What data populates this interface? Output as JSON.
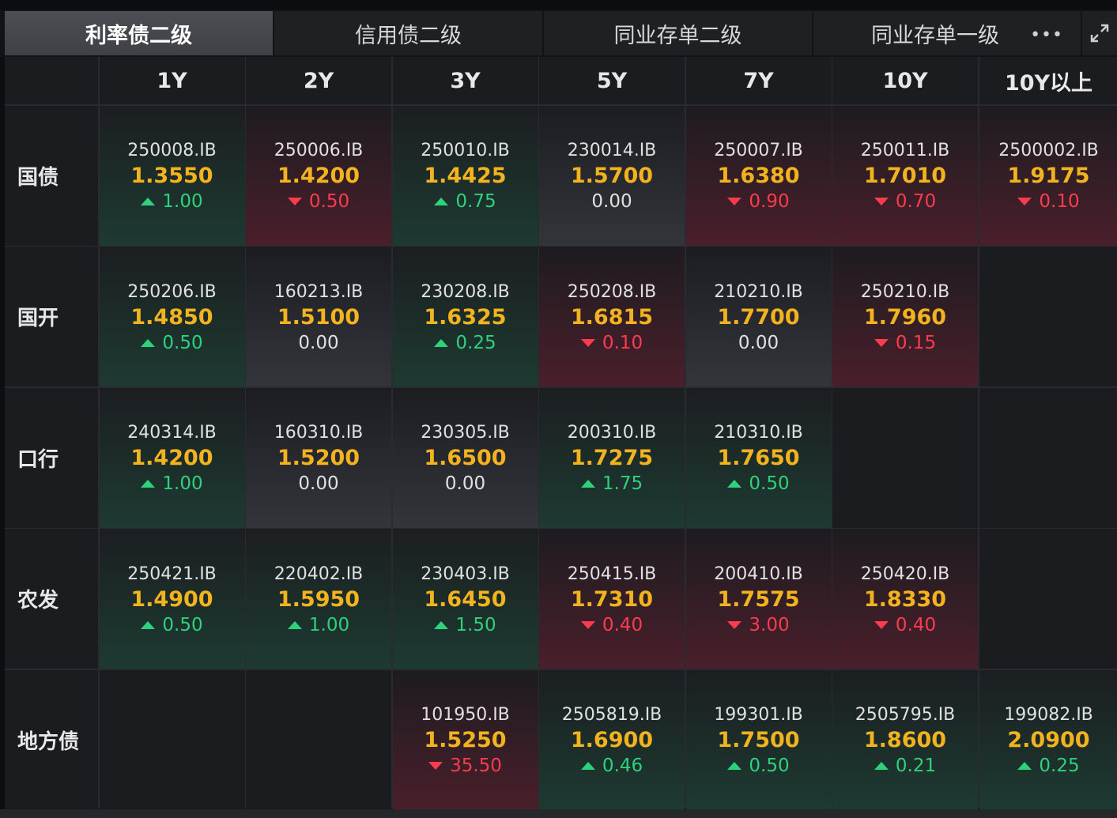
{
  "tabs": [
    {
      "label": "利率债二级",
      "active": true
    },
    {
      "label": "信用债二级",
      "active": false
    },
    {
      "label": "同业存单二级",
      "active": false
    },
    {
      "label": "同业存单一级",
      "active": false
    }
  ],
  "icons": {
    "more": "more-horizontal-icon",
    "expand": "expand-icon"
  },
  "colors": {
    "rate": "#f2b31f",
    "up": "#2ed17c",
    "down": "#ff3b4e"
  },
  "columns": [
    "1Y",
    "2Y",
    "3Y",
    "5Y",
    "7Y",
    "10Y",
    "10Y以上"
  ],
  "rows": [
    {
      "name": "国债",
      "cells": [
        {
          "code": "250008.IB",
          "rate": "1.3550",
          "change": "1.00",
          "dir": "up"
        },
        {
          "code": "250006.IB",
          "rate": "1.4200",
          "change": "0.50",
          "dir": "down"
        },
        {
          "code": "250010.IB",
          "rate": "1.4425",
          "change": "0.75",
          "dir": "up"
        },
        {
          "code": "230014.IB",
          "rate": "1.5700",
          "change": "0.00",
          "dir": "flat"
        },
        {
          "code": "250007.IB",
          "rate": "1.6380",
          "change": "0.90",
          "dir": "down"
        },
        {
          "code": "250011.IB",
          "rate": "1.7010",
          "change": "0.70",
          "dir": "down"
        },
        {
          "code": "2500002.IB",
          "rate": "1.9175",
          "change": "0.10",
          "dir": "down"
        }
      ]
    },
    {
      "name": "国开",
      "cells": [
        {
          "code": "250206.IB",
          "rate": "1.4850",
          "change": "0.50",
          "dir": "up"
        },
        {
          "code": "160213.IB",
          "rate": "1.5100",
          "change": "0.00",
          "dir": "flat"
        },
        {
          "code": "230208.IB",
          "rate": "1.6325",
          "change": "0.25",
          "dir": "up"
        },
        {
          "code": "250208.IB",
          "rate": "1.6815",
          "change": "0.10",
          "dir": "down"
        },
        {
          "code": "210210.IB",
          "rate": "1.7700",
          "change": "0.00",
          "dir": "flat"
        },
        {
          "code": "250210.IB",
          "rate": "1.7960",
          "change": "0.15",
          "dir": "down"
        },
        null
      ]
    },
    {
      "name": "口行",
      "cells": [
        {
          "code": "240314.IB",
          "rate": "1.4200",
          "change": "1.00",
          "dir": "up"
        },
        {
          "code": "160310.IB",
          "rate": "1.5200",
          "change": "0.00",
          "dir": "flat"
        },
        {
          "code": "230305.IB",
          "rate": "1.6500",
          "change": "0.00",
          "dir": "flat"
        },
        {
          "code": "200310.IB",
          "rate": "1.7275",
          "change": "1.75",
          "dir": "up"
        },
        {
          "code": "210310.IB",
          "rate": "1.7650",
          "change": "0.50",
          "dir": "up"
        },
        null,
        null
      ]
    },
    {
      "name": "农发",
      "cells": [
        {
          "code": "250421.IB",
          "rate": "1.4900",
          "change": "0.50",
          "dir": "up"
        },
        {
          "code": "220402.IB",
          "rate": "1.5950",
          "change": "1.00",
          "dir": "up"
        },
        {
          "code": "230403.IB",
          "rate": "1.6450",
          "change": "1.50",
          "dir": "up"
        },
        {
          "code": "250415.IB",
          "rate": "1.7310",
          "change": "0.40",
          "dir": "down"
        },
        {
          "code": "200410.IB",
          "rate": "1.7575",
          "change": "3.00",
          "dir": "down"
        },
        {
          "code": "250420.IB",
          "rate": "1.8330",
          "change": "0.40",
          "dir": "down"
        },
        null
      ]
    },
    {
      "name": "地方债",
      "cells": [
        null,
        null,
        {
          "code": "101950.IB",
          "rate": "1.5250",
          "change": "35.50",
          "dir": "down"
        },
        {
          "code": "2505819.IB",
          "rate": "1.6900",
          "change": "0.46",
          "dir": "up"
        },
        {
          "code": "199301.IB",
          "rate": "1.7500",
          "change": "0.50",
          "dir": "up"
        },
        {
          "code": "2505795.IB",
          "rate": "1.8600",
          "change": "0.21",
          "dir": "up"
        },
        {
          "code": "199082.IB",
          "rate": "2.0900",
          "change": "0.25",
          "dir": "up"
        }
      ]
    }
  ]
}
